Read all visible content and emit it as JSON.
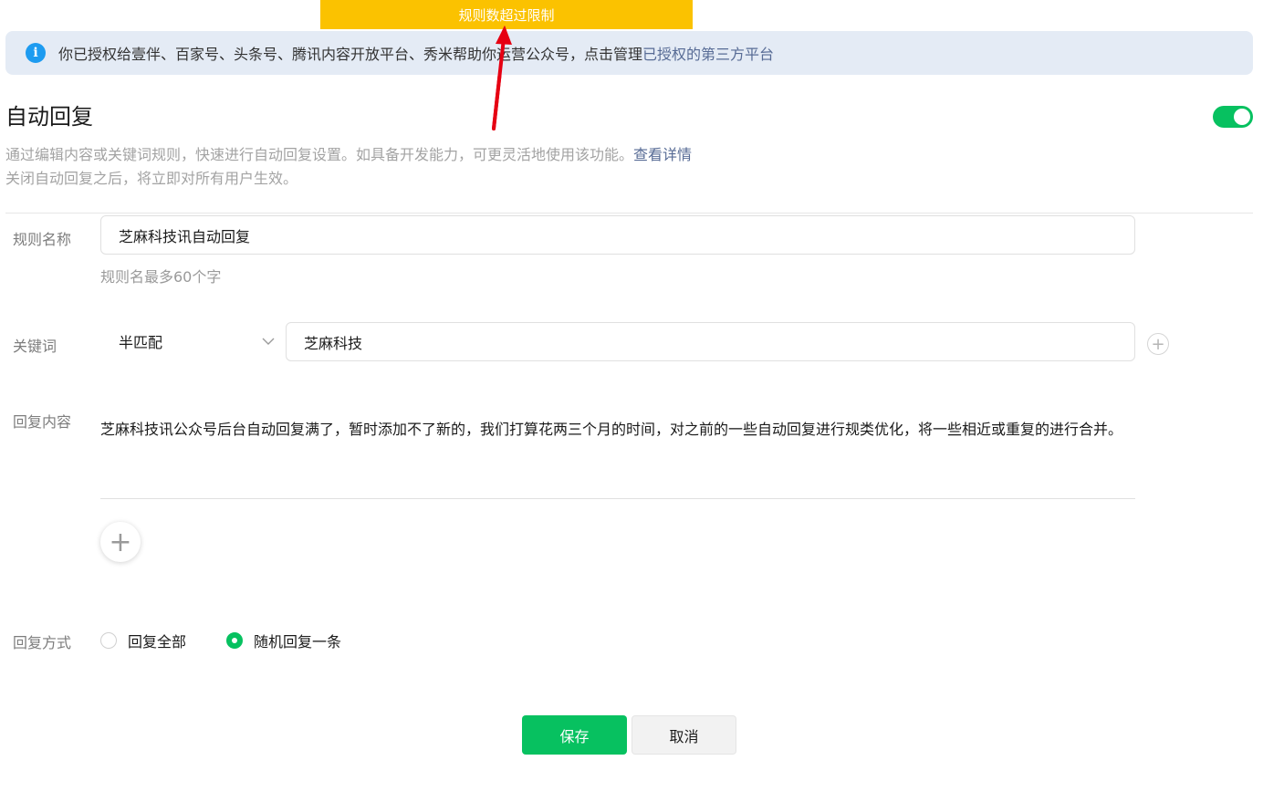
{
  "toast": {
    "text": "规则数超过限制"
  },
  "notice": {
    "text": "你已授权给壹伴、百家号、头条号、腾讯内容开放平台、秀米帮助你运营公众号，点击管理",
    "link": "已授权的第三方平台"
  },
  "header": {
    "title": "自动回复",
    "enabled": true,
    "desc1": "通过编辑内容或关键词规则，快速进行自动回复设置。如具备开发能力，可更灵活地使用该功能。",
    "desc1_link": "查看详情",
    "desc2": "关闭自动回复之后，将立即对所有用户生效。"
  },
  "form": {
    "rule_name_label": "规则名称",
    "rule_name_value": "芝麻科技讯自动回复",
    "rule_name_hint": "规则名最多60个字",
    "keyword_label": "关键词",
    "match_mode": "半匹配",
    "keyword_value": "芝麻科技",
    "reply_content_label": "回复内容",
    "reply_text": "芝麻科技讯公众号后台自动回复满了，暂时添加不了新的，我们打算花两三个月的时间，对之前的一些自动回复进行规类优化，将一些相近或重复的进行合并。",
    "reply_mode_label": "回复方式",
    "reply_mode_options": [
      "回复全部",
      "随机回复一条"
    ],
    "reply_mode_selected": "随机回复一条"
  },
  "buttons": {
    "save": "保存",
    "cancel": "取消"
  },
  "colors": {
    "accent": "#07c160",
    "toast": "#fbc200",
    "link": "#576b95",
    "annotation_arrow": "#e60012"
  },
  "icons": [
    "info-icon",
    "plus-icon",
    "chevron-down-icon",
    "arrow-annotation"
  ]
}
